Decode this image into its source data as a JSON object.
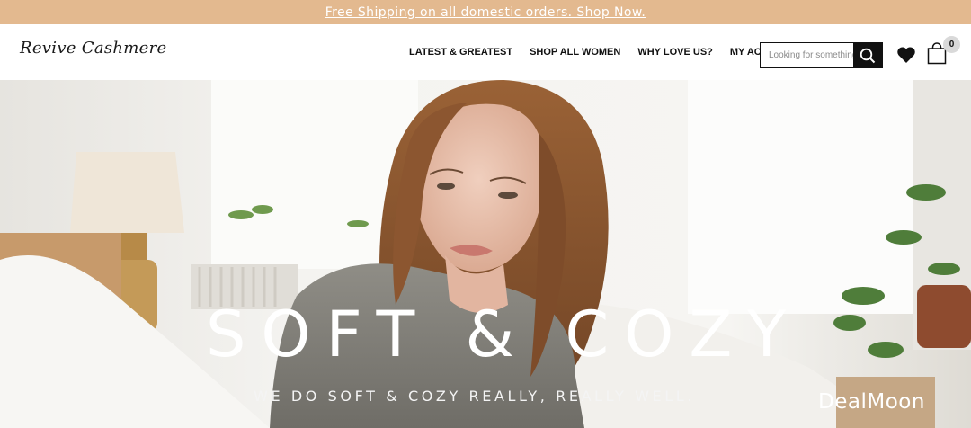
{
  "promo": {
    "text": "Free Shipping on all domestic orders. Shop Now."
  },
  "header": {
    "logo_text": "Revive Cashmere",
    "nav": [
      {
        "label": "LATEST & GREATEST"
      },
      {
        "label": "SHOP ALL WOMEN"
      },
      {
        "label": "WHY LOVE US?"
      },
      {
        "label": "MY ACCOUNT"
      }
    ],
    "search": {
      "placeholder": "Looking for something"
    },
    "cart": {
      "count": "0"
    }
  },
  "hero": {
    "title": "SOFT & COZY",
    "subtitle": "WE DO SOFT & COZY REALLY, REALLY WELL."
  },
  "watermark": {
    "text": "DealMoon"
  },
  "colors": {
    "promo_bg": "#e3b98f",
    "search_button": "#111111"
  },
  "icons": [
    "search-icon",
    "heart-icon",
    "shopping-bag-icon"
  ]
}
